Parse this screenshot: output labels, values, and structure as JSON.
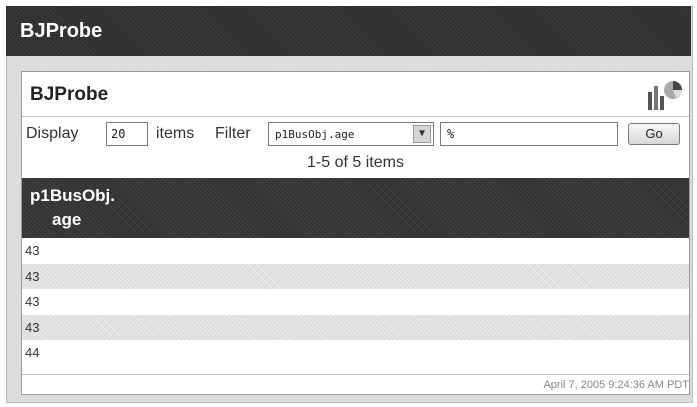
{
  "window": {
    "title": "BJProbe"
  },
  "panel": {
    "title": "BJProbe",
    "display_label": "Display",
    "items_count": "20",
    "items_label": "items",
    "filter_label": "Filter",
    "filter_field": "p1BusObj.age",
    "filter_value": "%",
    "go_label": "Go",
    "pager_text": "1-5 of 5 items"
  },
  "table": {
    "column_header_line1": "p1BusObj.",
    "column_header_line2": "age",
    "rows": [
      "43",
      "43",
      "43",
      "43",
      "44"
    ]
  },
  "footer": {
    "timestamp": "April 7, 2005 9:24:36 AM PDT"
  },
  "icons": {
    "chart": "chart-icon",
    "dropdown": "chevron-down-icon"
  }
}
